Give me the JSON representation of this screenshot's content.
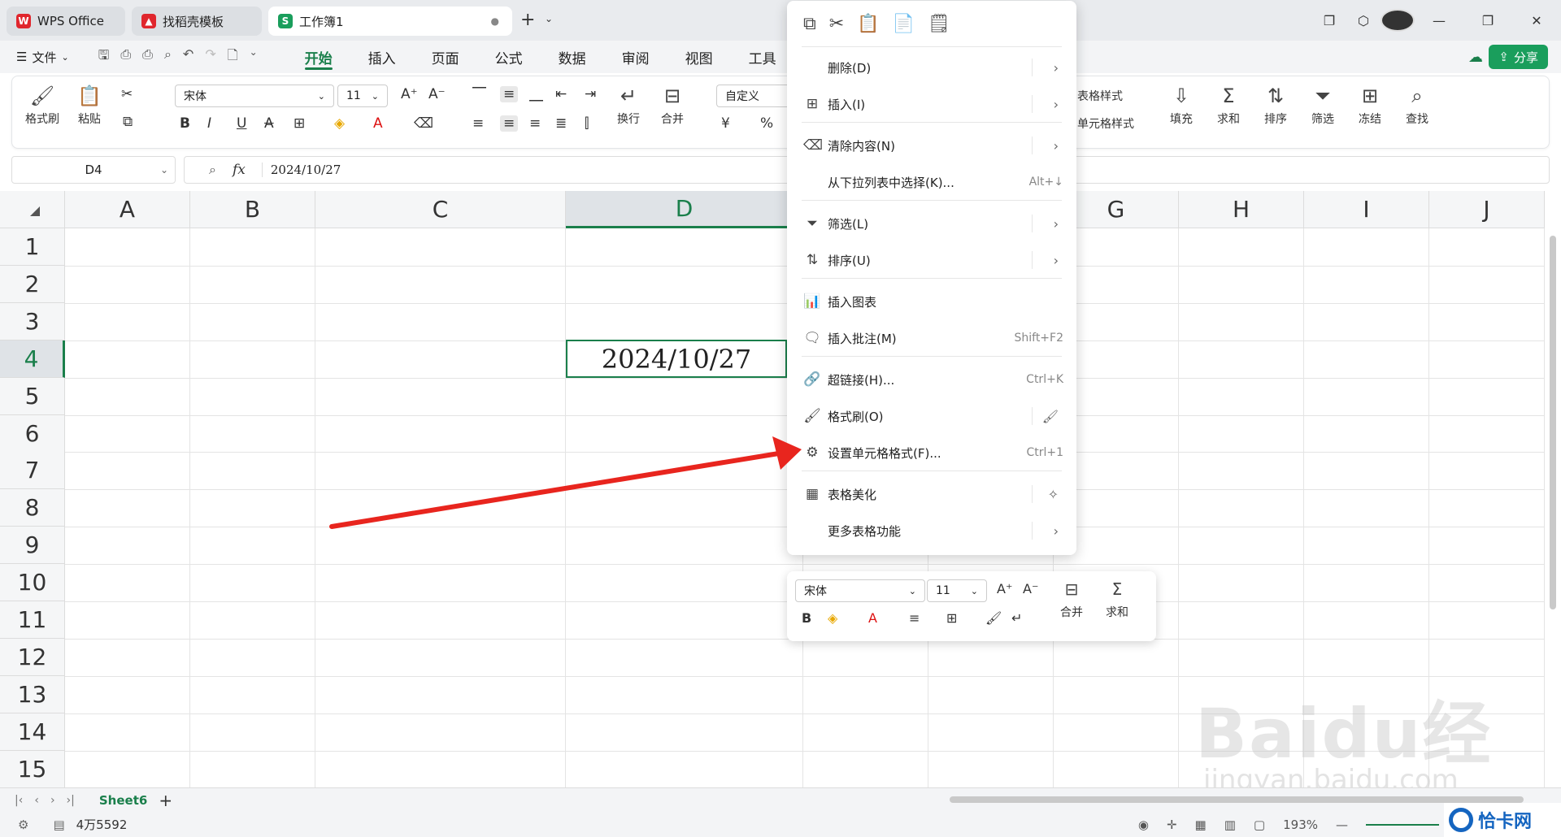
{
  "tabs": [
    {
      "label": "WPS Office",
      "color": "#e0262d",
      "glyph": "W"
    },
    {
      "label": "找稻壳模板",
      "color": "#e0262d",
      "glyph": "▲"
    },
    {
      "label": "工作簿1",
      "color": "#1a9e5c",
      "glyph": "S"
    }
  ],
  "menubar": {
    "file_label": "文件",
    "tabs": [
      "开始",
      "插入",
      "页面",
      "公式",
      "数据",
      "审阅",
      "视图",
      "工具"
    ],
    "active_tab": "开始",
    "share_label": "分享"
  },
  "ribbon": {
    "format_painter": "格式刷",
    "paste": "粘贴",
    "font_name": "宋体",
    "font_size": "11",
    "wrap": "换行",
    "merge": "合并",
    "number_format": "自定义",
    "currency": "¥",
    "percent": "%",
    "table_style": "表格样式",
    "cell_style": "单元格样式",
    "fill": "填充",
    "sum": "求和",
    "sort": "排序",
    "filter": "筛选",
    "freeze": "冻结",
    "find": "查找"
  },
  "formula_bar": {
    "cell_ref": "D4",
    "fx": "fx",
    "value": "2024/10/27"
  },
  "grid": {
    "columns": [
      "A",
      "B",
      "C",
      "D",
      "E",
      "F",
      "G",
      "H",
      "I",
      "J"
    ],
    "rows": [
      "1",
      "2",
      "3",
      "4",
      "5",
      "6",
      "7",
      "8",
      "9",
      "10",
      "11",
      "12",
      "13",
      "14",
      "15"
    ],
    "selected_column": "D",
    "selected_row": "4",
    "active_cell_value": "2024/10/27"
  },
  "context_menu": {
    "items": [
      {
        "label": "删除(D)",
        "shortcut": "",
        "submenu": true,
        "icon": "none"
      },
      {
        "label": "插入(I)",
        "shortcut": "",
        "submenu": true,
        "icon": "insert-icon"
      },
      {
        "label": "清除内容(N)",
        "shortcut": "",
        "submenu": true,
        "icon": "clear-icon"
      },
      {
        "label": "从下拉列表中选择(K)...",
        "shortcut": "Alt+↓",
        "submenu": false,
        "icon": "none"
      },
      {
        "label": "筛选(L)",
        "shortcut": "",
        "submenu": true,
        "icon": "filter-icon"
      },
      {
        "label": "排序(U)",
        "shortcut": "",
        "submenu": true,
        "icon": "sort-icon"
      },
      {
        "label": "插入图表",
        "shortcut": "",
        "submenu": false,
        "icon": "chart-icon"
      },
      {
        "label": "插入批注(M)",
        "shortcut": "Shift+F2",
        "submenu": false,
        "icon": "comment-icon"
      },
      {
        "label": "超链接(H)...",
        "shortcut": "Ctrl+K",
        "submenu": false,
        "icon": "link-icon"
      },
      {
        "label": "格式刷(O)",
        "shortcut": "",
        "submenu": false,
        "icon": "format-painter-icon"
      },
      {
        "label": "设置单元格格式(F)...",
        "shortcut": "Ctrl+1",
        "submenu": false,
        "icon": "cell-format-icon"
      },
      {
        "label": "表格美化",
        "shortcut": "",
        "submenu": false,
        "icon": "table-beautify-icon"
      },
      {
        "label": "更多表格功能",
        "shortcut": "",
        "submenu": true,
        "icon": "none"
      }
    ]
  },
  "mini_toolbar": {
    "font_name": "宋体",
    "font_size": "11",
    "merge": "合并",
    "sum": "求和"
  },
  "sheets": {
    "active": "Sheet6"
  },
  "status": {
    "count": "4万5592",
    "zoom": "193%"
  },
  "watermark": {
    "brand": "Baidu经验",
    "url": "jingyan.baidu.com",
    "badge": "恰卡网"
  },
  "colors": {
    "accent": "#1a7f4b",
    "annotation_arrow": "#e8251e"
  }
}
